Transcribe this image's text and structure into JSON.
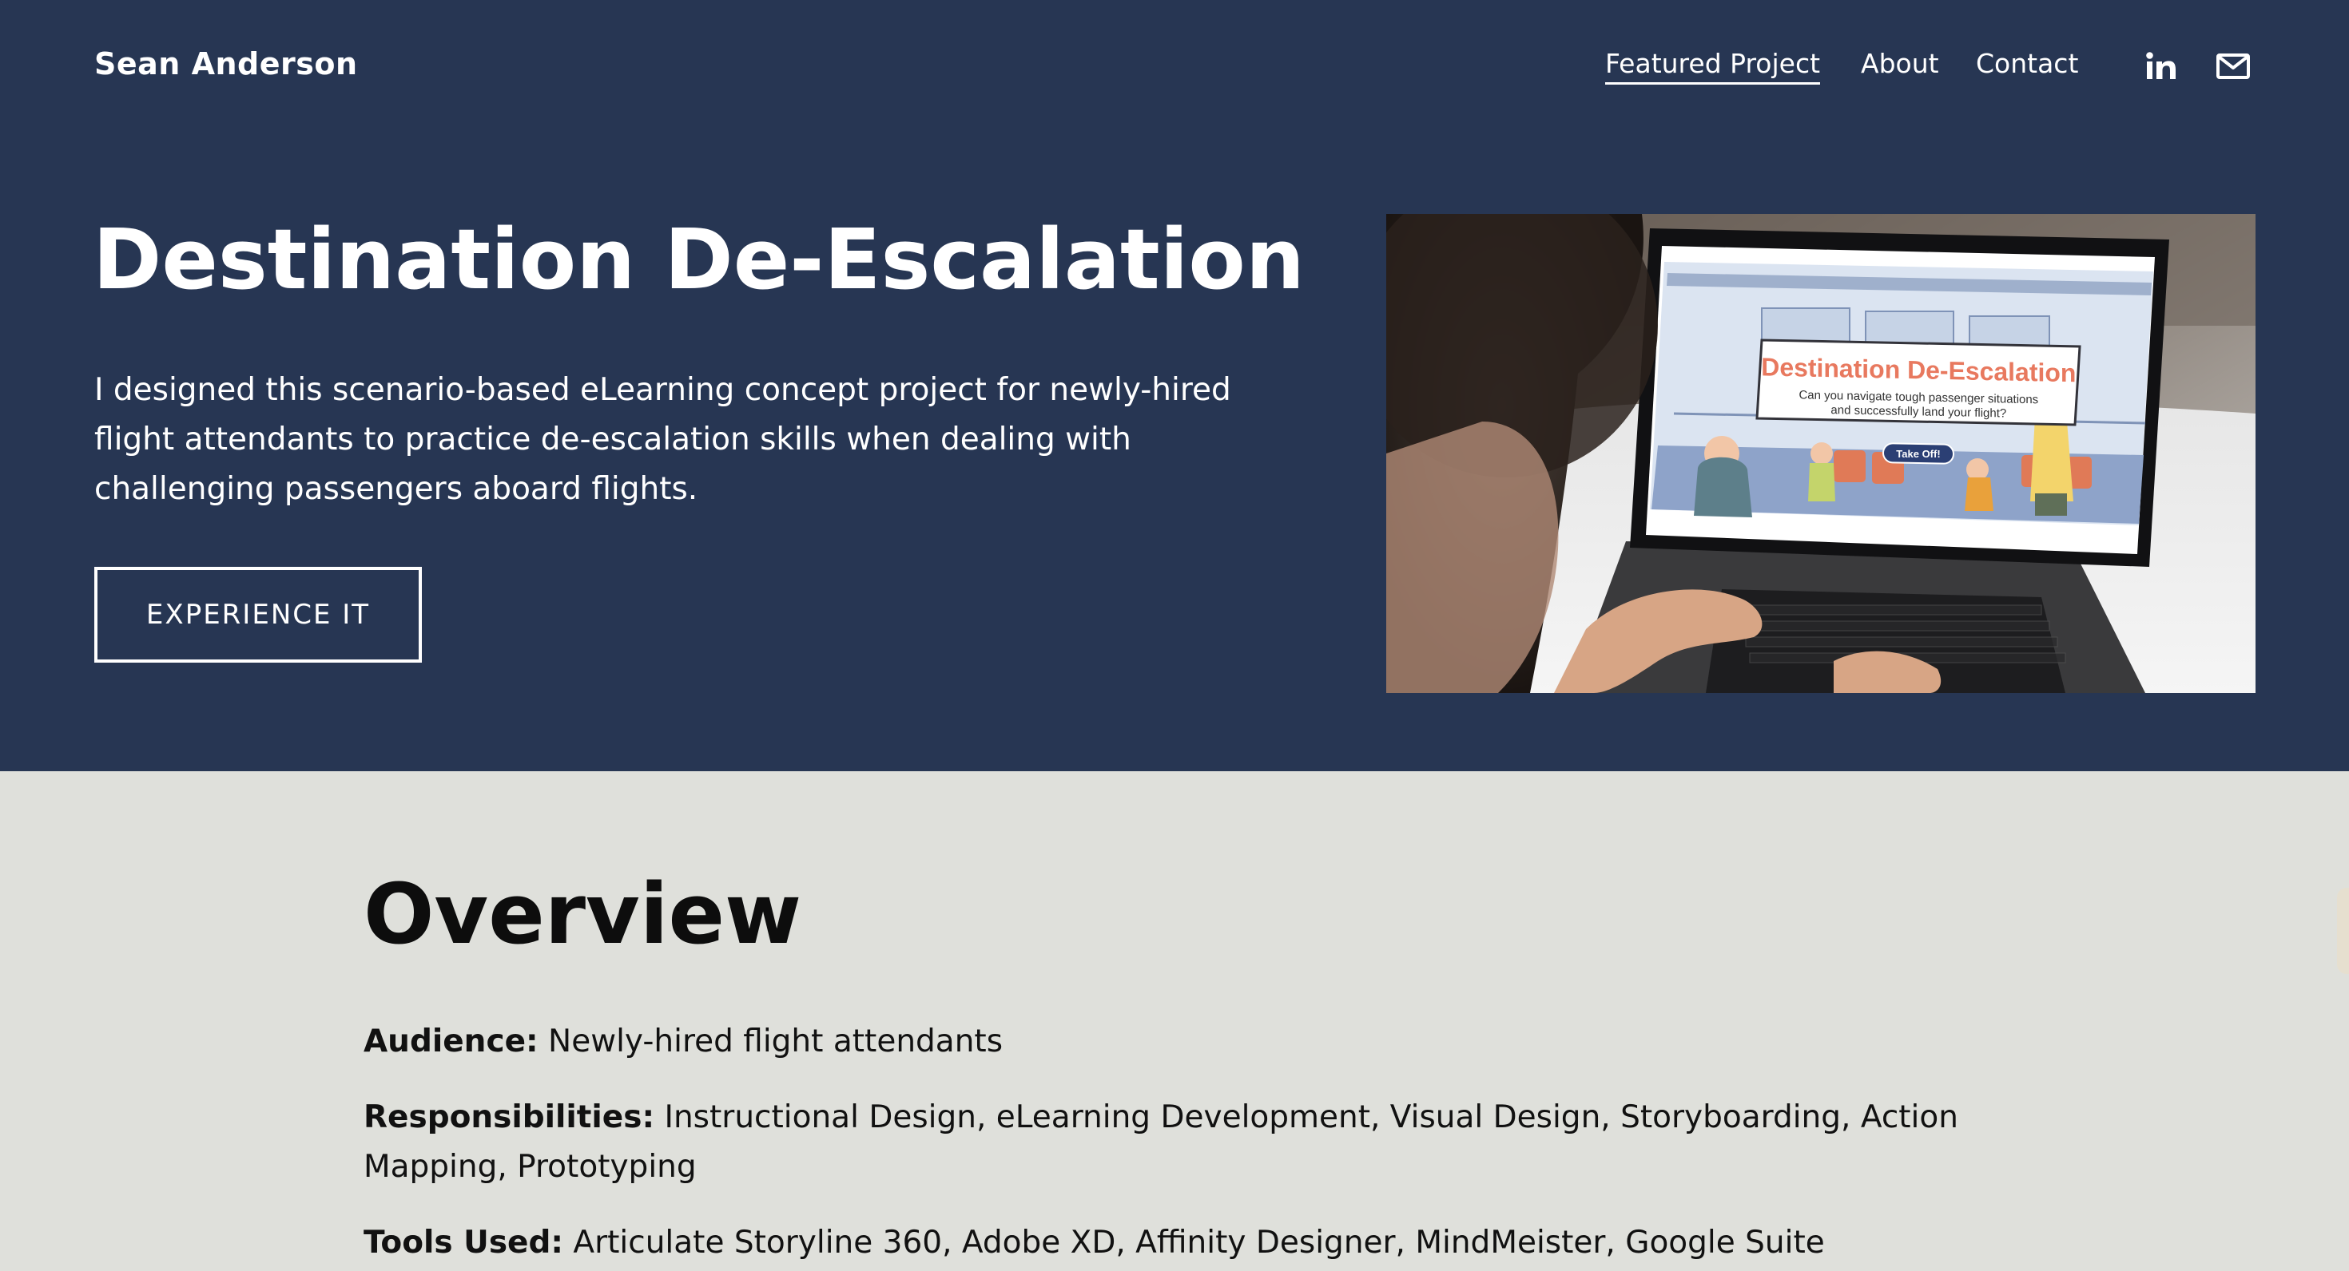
{
  "header": {
    "site_title": "Sean Anderson",
    "nav": [
      {
        "label": "Featured Project",
        "active": true
      },
      {
        "label": "About",
        "active": false
      },
      {
        "label": "Contact",
        "active": false
      }
    ],
    "social_icons": [
      "linkedin-icon",
      "email-icon"
    ]
  },
  "hero": {
    "title": "Destination De-Escalation",
    "description": "I designed this scenario-based eLearning concept project for newly-hired flight attendants to practice de-escalation skills when dealing with challenging passengers aboard flights.",
    "cta_label": "EXPERIENCE IT",
    "image": {
      "screen_title": "Destination De-Escalation",
      "screen_subtitle_line1": "Can you navigate tough passenger situations",
      "screen_subtitle_line2": "and successfully land your flight?",
      "screen_button": "Take Off!"
    }
  },
  "overview": {
    "title": "Overview",
    "items": [
      {
        "label": "Audience:",
        "value": "Newly-hired flight attendants"
      },
      {
        "label": "Responsibilities:",
        "value": "Instructional Design, eLearning Development, Visual Design, Storyboarding, Action Mapping, Prototyping"
      },
      {
        "label": "Tools Used:",
        "value": "Articulate Storyline 360, Adobe XD, Affinity Designer, MindMeister, Google Suite"
      }
    ]
  },
  "colors": {
    "hero_bg": "#273653",
    "overview_bg": "#dfe0db",
    "screen_title_color": "#e8795f",
    "screen_button_bg": "#2b3f74"
  }
}
